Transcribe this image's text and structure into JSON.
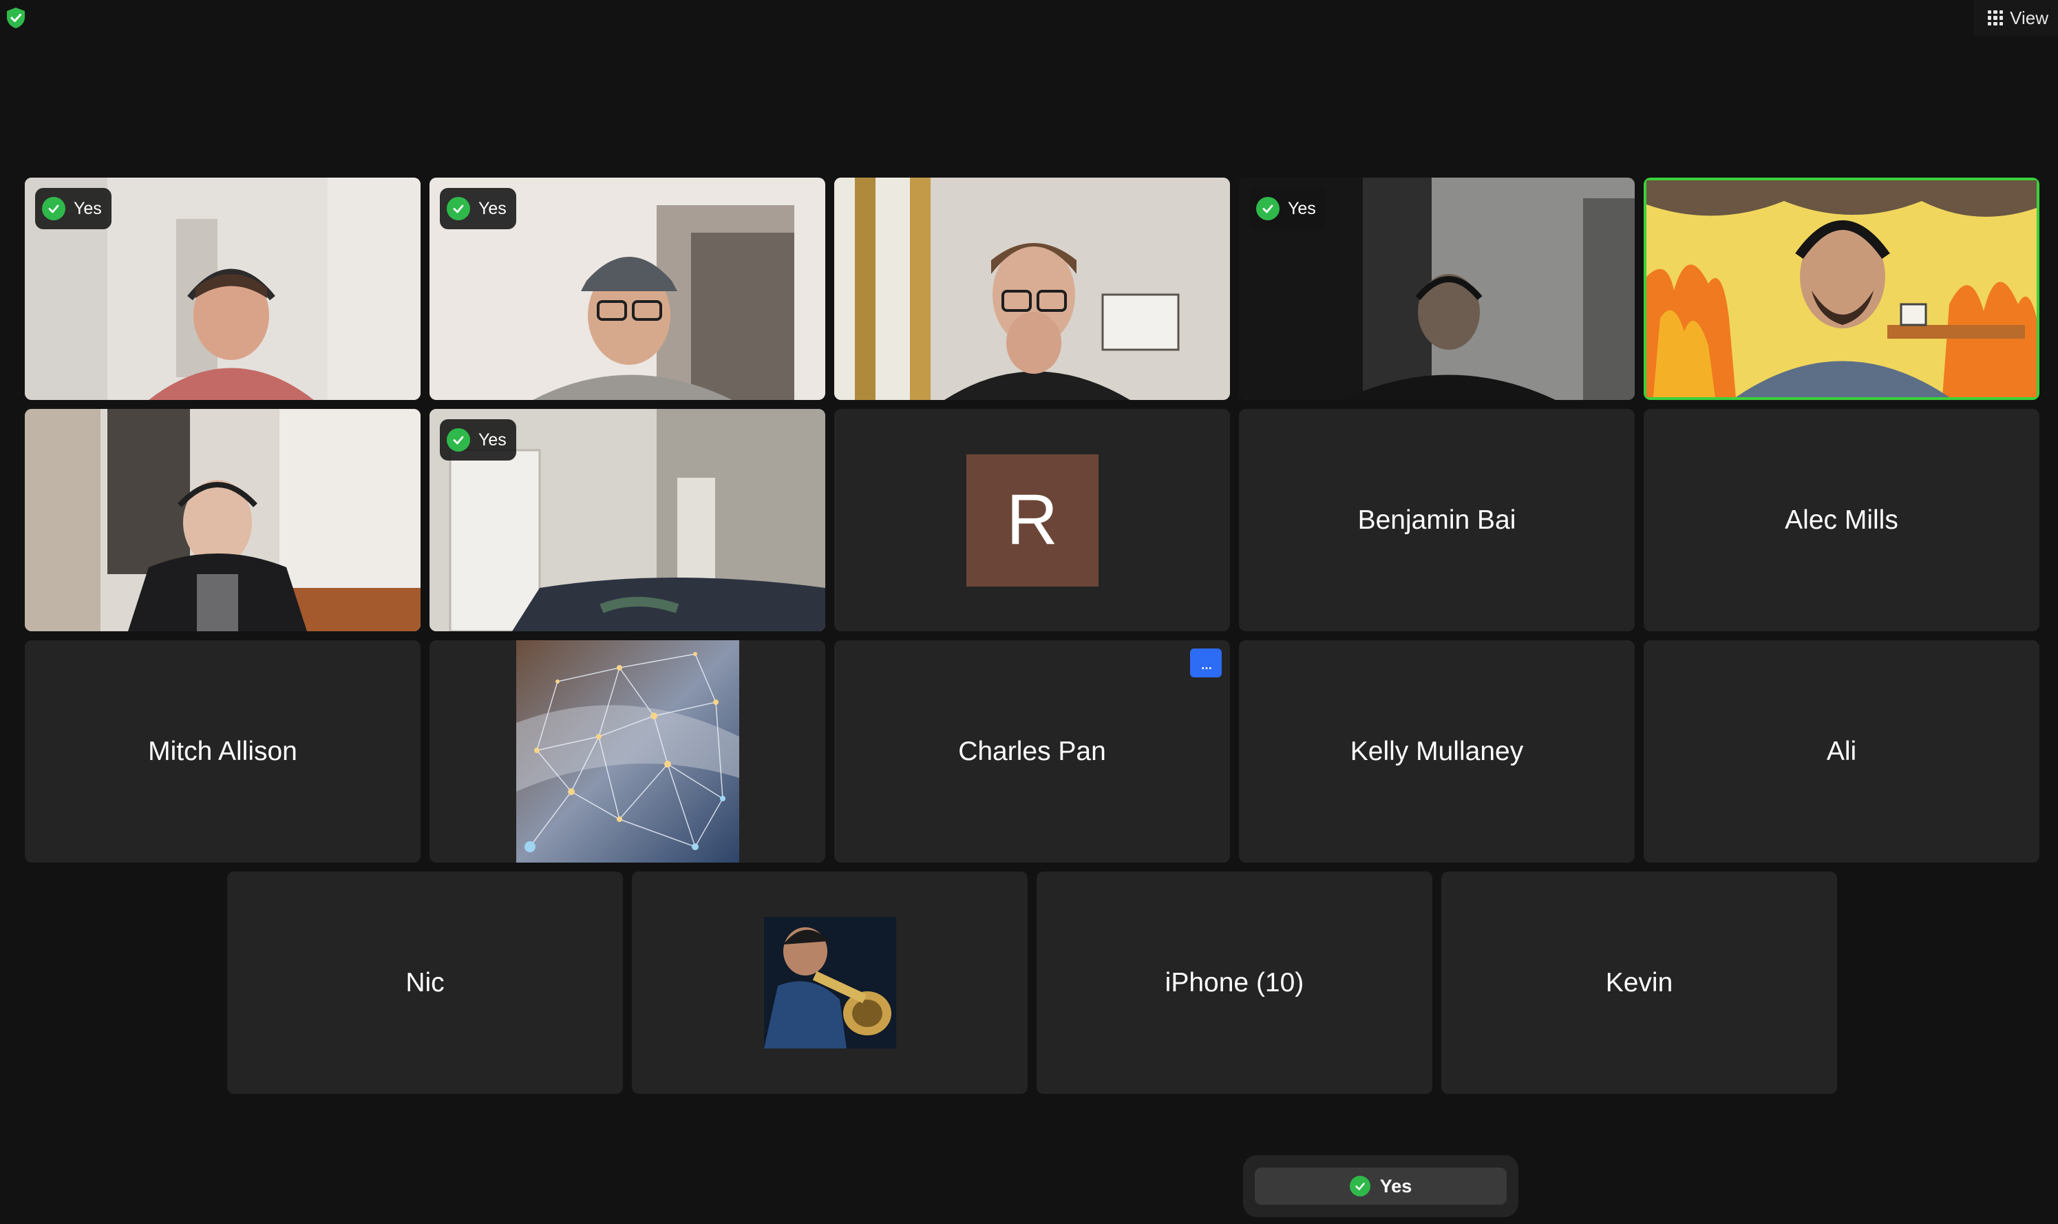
{
  "toolbar": {
    "view_label": "View",
    "icons": [
      "shield-check-icon",
      "grid-icon"
    ]
  },
  "colors": {
    "background": "#121212",
    "tile": "#242424",
    "active_speaker_border": "#3bd13b",
    "check_green": "#2fb94b",
    "more_button_blue": "#2d6cf4",
    "avatar_r_bg": "#6b4638"
  },
  "reaction_badge_label": "Yes",
  "participants": [
    {
      "id": 1,
      "type": "video",
      "reaction": "Yes"
    },
    {
      "id": 2,
      "type": "video",
      "reaction": "Yes"
    },
    {
      "id": 3,
      "type": "video",
      "reaction": ""
    },
    {
      "id": 4,
      "type": "video",
      "reaction": "Yes"
    },
    {
      "id": 5,
      "type": "video",
      "reaction": "",
      "active_speaker": true
    },
    {
      "id": 6,
      "type": "video",
      "reaction": ""
    },
    {
      "id": 7,
      "type": "video",
      "reaction": "Yes"
    },
    {
      "id": 8,
      "type": "avatar",
      "initial": "R"
    },
    {
      "id": 9,
      "type": "name",
      "name": "Benjamin Bai"
    },
    {
      "id": 10,
      "type": "name",
      "name": "Alec Mills"
    },
    {
      "id": 11,
      "type": "name",
      "name": "Mitch Allison"
    },
    {
      "id": 12,
      "type": "picture"
    },
    {
      "id": 13,
      "type": "name",
      "name": "Charles Pan",
      "more_button": "..."
    },
    {
      "id": 14,
      "type": "name",
      "name": "Kelly Mullaney"
    },
    {
      "id": 15,
      "type": "name",
      "name": "Ali"
    },
    {
      "id": 16,
      "type": "name",
      "name": "Nic"
    },
    {
      "id": 17,
      "type": "picture"
    },
    {
      "id": 18,
      "type": "name",
      "name": "iPhone (10)"
    },
    {
      "id": 19,
      "type": "name",
      "name": "Kevin"
    }
  ],
  "bottom_reaction": {
    "label": "Yes"
  }
}
